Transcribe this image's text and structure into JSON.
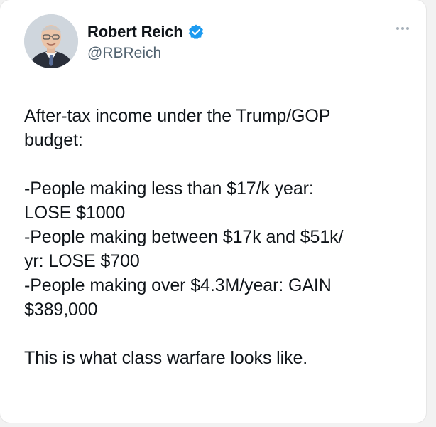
{
  "author": {
    "name": "Robert Reich",
    "handle": "@RBReich",
    "verified": true,
    "verified_color": "#1d9bf0"
  },
  "tweet": {
    "lines": [
      "After-tax income under the Trump/GOP",
      "budget:",
      "-People making less than $17/k year:",
      "LOSE $1000",
      "-People making between $17k and $51k/",
      "yr: LOSE $700",
      "-People making over $4.3M/year: GAIN",
      "$389,000",
      "This is what class warfare looks like."
    ]
  },
  "icons": {
    "more": "more-options-icon",
    "verified": "verified-badge-icon"
  }
}
